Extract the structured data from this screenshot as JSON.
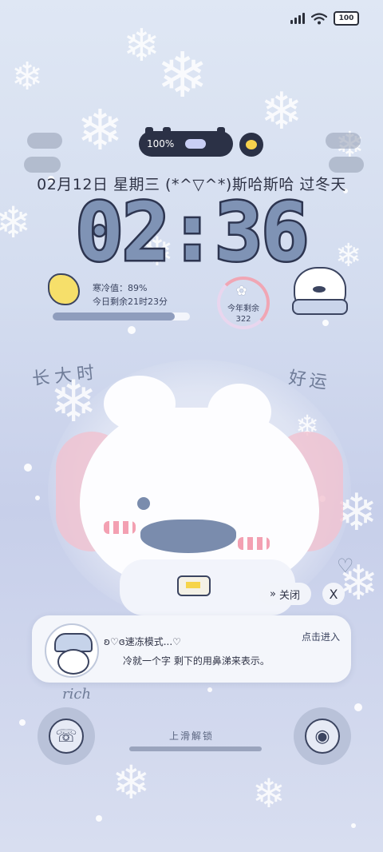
{
  "status_bar": {
    "battery": "100"
  },
  "top_widget": {
    "battery_percent": "100%"
  },
  "date_line": "02月12日 星期三 (*^▽^*)斯哈斯哈 过冬天",
  "clock": "02:36",
  "cold_widget": {
    "cold_value": "寒冷值：89%",
    "remaining_today": "今日剩余21时23分",
    "progress": 0.89
  },
  "year_widget": {
    "label": "今年剩余",
    "value": "322"
  },
  "handwriting": {
    "left": "长大时",
    "right": "好运",
    "bottom": "rich"
  },
  "close_button": {
    "label": "关闭",
    "chevron": "»"
  },
  "close_x": "X",
  "notification": {
    "title": "ʚ♡ɞ速冻模式...♡",
    "action": "点击进入",
    "body": "冷就一个字 剩下的用鼻涕来表示。"
  },
  "bottom": {
    "swipe_text": "上滑解锁"
  },
  "icons": [
    "signal-icon",
    "wifi-icon",
    "battery-icon",
    "phone-icon",
    "camera-icon",
    "moon-icon",
    "snowflake-icon",
    "heart-icon"
  ],
  "colors": {
    "background": "#d3dcef",
    "clock_fill": "#7f93b5",
    "clock_stroke": "#2d3550",
    "accent_pink": "#f0a6b4",
    "accent_yellow": "#f6d44a"
  }
}
